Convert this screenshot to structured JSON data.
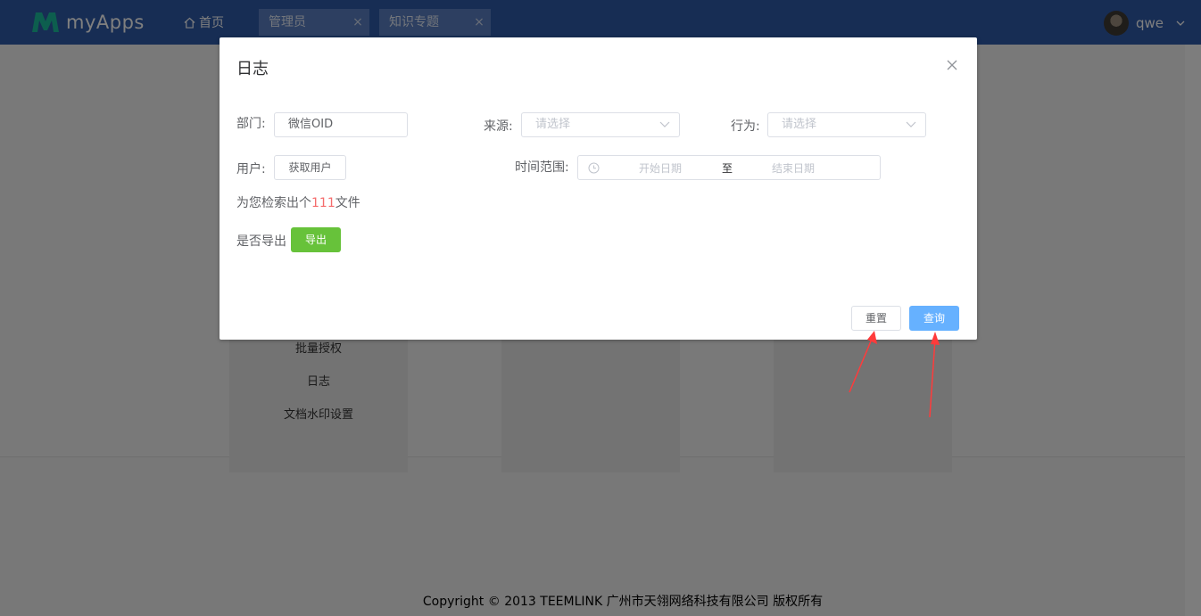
{
  "header": {
    "app_name": "myApps",
    "home_label": "首页",
    "tabs": [
      {
        "label": "管理员",
        "close": "×"
      },
      {
        "label": "知识专题",
        "close": "×"
      }
    ],
    "user_name": "qwe"
  },
  "background_menu": {
    "items": [
      "批量授权",
      "日志",
      "文档水印设置"
    ]
  },
  "footer": {
    "copyright": "Copyright © 2013 TEEMLINK 广州市天翎网络科技有限公司 版权所有"
  },
  "dialog": {
    "title": "日志",
    "department_label": "部门:",
    "department_value": "微信OID",
    "source_label": "来源:",
    "source_placeholder": "请选择",
    "action_label": "行为:",
    "action_placeholder": "请选择",
    "user_label": "用户:",
    "get_user_button": "获取用户",
    "time_range_label": "时间范围:",
    "start_date_placeholder": "开始日期",
    "range_separator": "至",
    "end_date_placeholder": "结束日期",
    "result_prefix": "为您检索出个",
    "result_count": "111",
    "result_suffix": "文件",
    "export_label": "是否导出",
    "export_button": "导出",
    "reset_button": "重置",
    "query_button": "查询"
  },
  "colors": {
    "header_bg": "#2f5aa8",
    "export_green": "#67c23a",
    "query_blue": "#66b1ff",
    "count_red": "#f56c6c",
    "arrow_red": "#ff3b3b"
  }
}
